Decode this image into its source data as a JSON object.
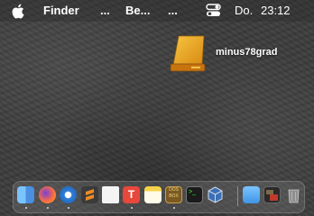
{
  "menubar": {
    "app_name": "Finder",
    "menu_more_1": "...",
    "menu_be": "Be...",
    "menu_more_2": "...",
    "day": "Do.",
    "time": "23:12"
  },
  "desktop": {
    "drive_label": "minus78grad",
    "drive_icon": "external-drive-icon"
  },
  "dock": {
    "apps": [
      {
        "name": "finder",
        "color": "#4a9ff5",
        "running": true
      },
      {
        "name": "firefox",
        "color": "#ff7139",
        "running": true
      },
      {
        "name": "thunderbird",
        "color": "#2f7ed8",
        "running": true
      },
      {
        "name": "sublime-text",
        "color": "#f08a24",
        "running": false
      },
      {
        "name": "text-document",
        "color": "#f1f1f1",
        "running": false
      },
      {
        "name": "typora",
        "color": "#e8473c",
        "running": true
      },
      {
        "name": "notes",
        "color": "#f7d34b",
        "running": false
      },
      {
        "name": "dosbox",
        "color": "#8a6a2a",
        "running": true
      },
      {
        "name": "terminal",
        "color": "#1b1b1b",
        "running": false
      },
      {
        "name": "virtualbox",
        "color": "#3b6fb6",
        "running": false
      },
      {
        "name": "downloads-folder",
        "color": "#5aaaf0",
        "running": false
      },
      {
        "name": "screenshot-preview",
        "color": "#2a2a2a",
        "running": false
      },
      {
        "name": "trash",
        "color": "#9a9a9a",
        "running": false
      }
    ]
  }
}
